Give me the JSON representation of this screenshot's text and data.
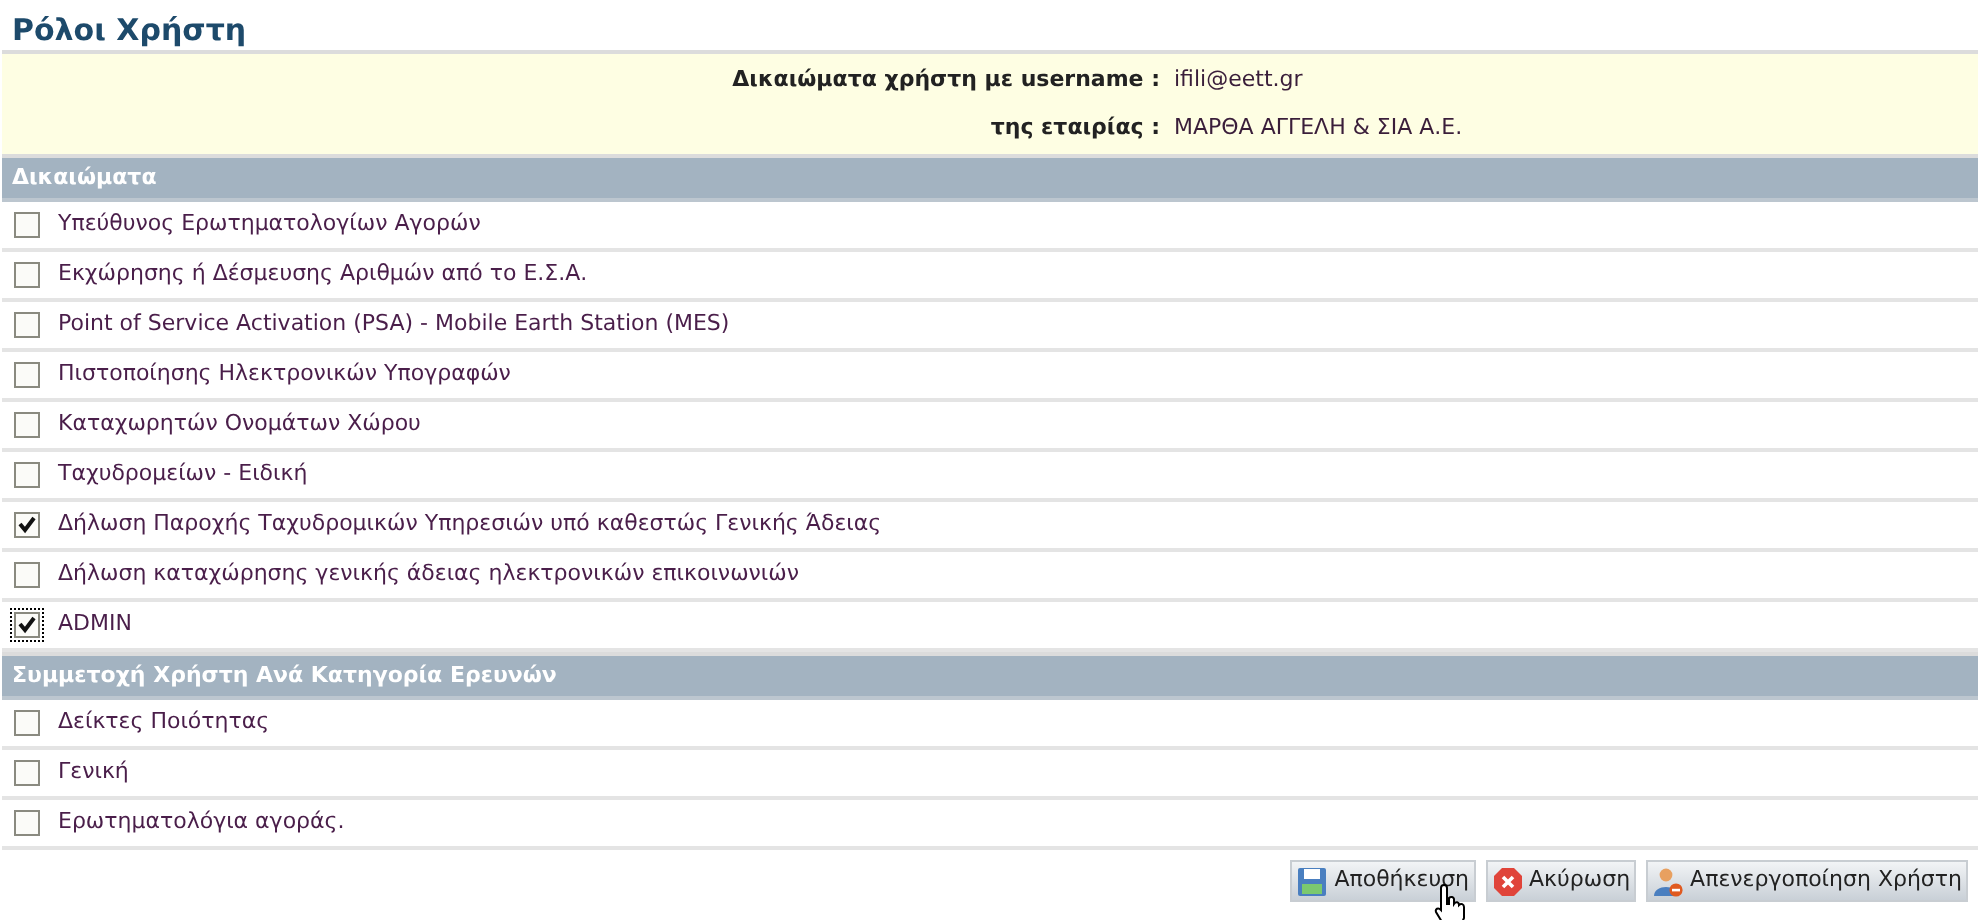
{
  "page_title": "Ρόλοι Χρήστη",
  "user_info": [
    {
      "label": "Δικαιώματα χρήστη με username :",
      "value": "ifili@eett.gr"
    },
    {
      "label": "της εταιρίας :",
      "value": "ΜΑΡΘΑ ΑΓΓΕΛΗ & ΣΙΑ Α.Ε."
    }
  ],
  "sections": [
    {
      "title": "Δικαιώματα",
      "items": [
        {
          "label": "Υπεύθυνος Ερωτηματολογίων Αγορών",
          "checked": false,
          "focused": false
        },
        {
          "label": "Εκχώρησης ή Δέσμευσης Αριθμών από το Ε.Σ.Α.",
          "checked": false,
          "focused": false
        },
        {
          "label": "Point of Service Activation (PSA) - Mobile Earth Station (MES)",
          "checked": false,
          "focused": false
        },
        {
          "label": "Πιστοποίησης Ηλεκτρονικών Υπογραφών",
          "checked": false,
          "focused": false
        },
        {
          "label": "Καταχωρητών Ονομάτων Χώρου",
          "checked": false,
          "focused": false
        },
        {
          "label": "Ταχυδρομείων - Ειδική",
          "checked": false,
          "focused": false
        },
        {
          "label": "Δήλωση Παροχής Ταχυδρομικών Υπηρεσιών υπό καθεστώς Γενικής Άδειας",
          "checked": true,
          "focused": false
        },
        {
          "label": "Δήλωση καταχώρησης γενικής άδειας ηλεκτρονικών επικοινωνιών",
          "checked": false,
          "focused": false
        },
        {
          "label": "ADMIN",
          "checked": true,
          "focused": true
        }
      ]
    },
    {
      "title": "Συμμετοχή Χρήστη Ανά Κατηγορία Ερευνών",
      "items": [
        {
          "label": "Δείκτες Ποιότητας",
          "checked": false,
          "focused": false
        },
        {
          "label": "Γενική",
          "checked": false,
          "focused": false
        },
        {
          "label": "Ερωτηματολόγια αγοράς.",
          "checked": false,
          "focused": false
        }
      ]
    }
  ],
  "buttons": [
    {
      "kind": "save",
      "label": "Αποθήκευση"
    },
    {
      "kind": "cancel",
      "label": "Ακύρωση"
    },
    {
      "kind": "deactivate",
      "label": "Απενεργοποίηση Χρήστη"
    }
  ]
}
